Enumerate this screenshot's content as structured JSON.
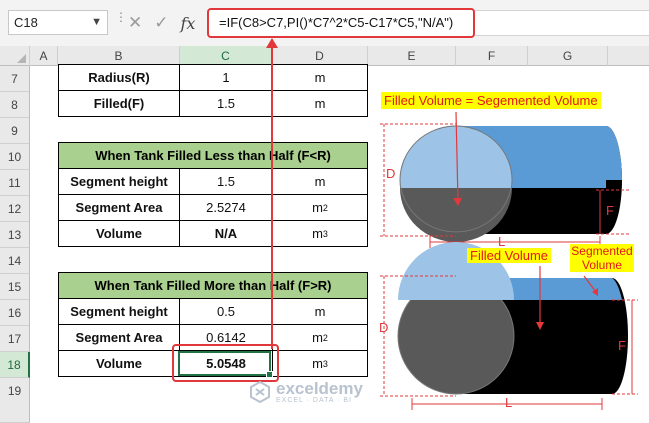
{
  "formula_bar": {
    "name_box": "C18",
    "fx_label": "fx",
    "formula": "=IF(C8>C7,PI()*C7^2*C5-C17*C5,\"N/A\")"
  },
  "columns": [
    "A",
    "B",
    "C",
    "D",
    "E",
    "F",
    "G"
  ],
  "selected_column": "C",
  "rows": [
    "7",
    "8",
    "9",
    "10",
    "11",
    "12",
    "13",
    "14",
    "15",
    "16",
    "17",
    "18",
    "19"
  ],
  "selected_row": "18",
  "inputs": {
    "radius_label": "Radius(R)",
    "radius_value": "1",
    "radius_unit": "m",
    "filled_label": "Filled(F)",
    "filled_value": "1.5",
    "filled_unit": "m"
  },
  "table_less": {
    "title": "When Tank Filled Less than Half (F<R)",
    "rows": [
      {
        "label": "Segment height",
        "value": "1.5",
        "unit": "m",
        "exp": ""
      },
      {
        "label": "Segment Area",
        "value": "2.5274",
        "unit": "m",
        "exp": "2"
      },
      {
        "label": "Volume",
        "value": "N/A",
        "unit": "m",
        "exp": "3"
      }
    ]
  },
  "table_more": {
    "title": "When Tank Filled More than Half (F>R)",
    "rows": [
      {
        "label": "Segment height",
        "value": "0.5",
        "unit": "m",
        "exp": ""
      },
      {
        "label": "Segment Area",
        "value": "0.6142",
        "unit": "m",
        "exp": "2"
      },
      {
        "label": "Volume",
        "value": "5.0548",
        "unit": "m",
        "exp": "3"
      }
    ]
  },
  "diagram": {
    "caption_top": "Filled Volume = Segemented Volume",
    "caption_filled": "Filled Volume",
    "caption_segmented": "Segmented Volume",
    "label_D": "D",
    "label_L": "L",
    "label_F": "F"
  },
  "watermark": {
    "name": "exceldemy",
    "tagline": "EXCEL · DATA · BI"
  },
  "colors": {
    "accent_red": "#e2383b",
    "header_green": "#a9d08e",
    "excel_green": "#217346",
    "tank_blue": "#5b9bd5",
    "tank_light": "#9dc3e6",
    "tank_dark": "#595959"
  }
}
